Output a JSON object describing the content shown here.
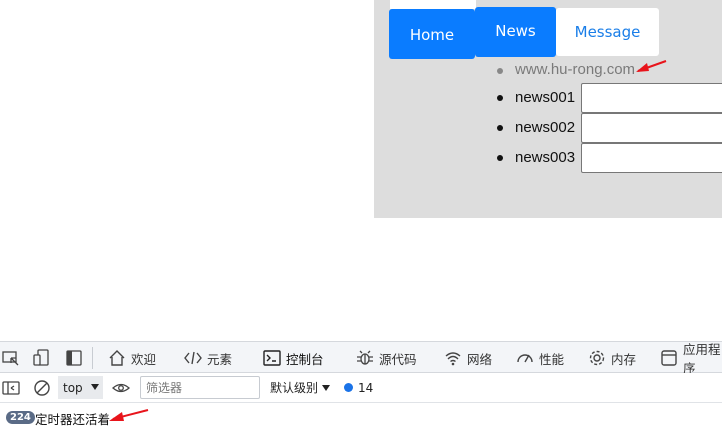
{
  "demo": {
    "tabs": [
      {
        "label": "Home",
        "active": true
      },
      {
        "label": "News",
        "active": true
      },
      {
        "label": "Message",
        "active": false
      }
    ],
    "list": [
      {
        "text": "www.hu-rong.com",
        "kind": "link"
      },
      {
        "text": "news001",
        "kind": "input"
      },
      {
        "text": "news002",
        "kind": "input"
      },
      {
        "text": "news003",
        "kind": "input"
      }
    ],
    "colors": {
      "tab_active": "#0a7cff",
      "panel_bg": "#dddddd",
      "annotation": "#e8141b"
    }
  },
  "devtools": {
    "tabs": [
      {
        "label": "欢迎",
        "icon": "home-icon"
      },
      {
        "label": "元素",
        "icon": "code-icon"
      },
      {
        "label": "控制台",
        "icon": "console-icon",
        "active": true
      },
      {
        "label": "源代码",
        "icon": "bug-icon"
      },
      {
        "label": "网络",
        "icon": "wifi-icon"
      },
      {
        "label": "性能",
        "icon": "gauge-icon"
      },
      {
        "label": "内存",
        "icon": "gear-icon"
      },
      {
        "label": "应用程序",
        "icon": "app-window-icon"
      }
    ],
    "toolbar": {
      "context": "top",
      "filter_placeholder": "筛选器",
      "level": "默认级别",
      "issues_count": "14"
    },
    "console": {
      "repeat_count": "224",
      "message": "定时器还活着"
    },
    "colors": {
      "accent": "#1a73e8",
      "badge": "#5a6b86"
    }
  }
}
